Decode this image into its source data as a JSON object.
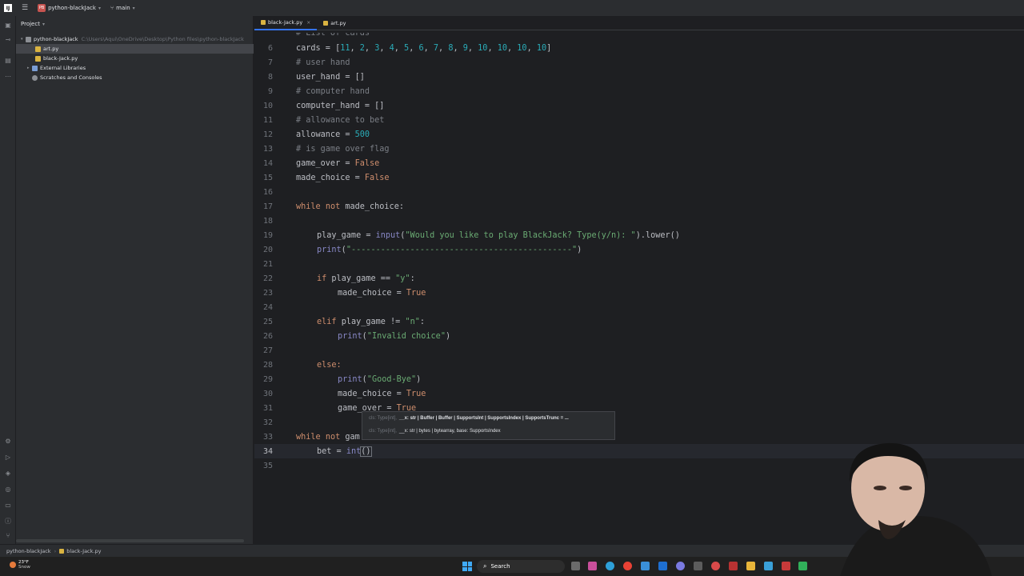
{
  "titlebar": {
    "logo": "IJ",
    "project_badge": "PB",
    "project_name": "python-blackJack",
    "branch": "main"
  },
  "project_panel": {
    "header": "Project",
    "items": [
      {
        "label": "python-blackJack",
        "path": "C:\\Users\\Aqui\\OneDrive\\Desktop\\Python files\\python-blackJack"
      },
      {
        "label": "art.py"
      },
      {
        "label": "black-Jack.py"
      },
      {
        "label": "External Libraries"
      },
      {
        "label": "Scratches and Consoles"
      }
    ]
  },
  "tabs": [
    {
      "label": "black-Jack.py"
    },
    {
      "label": "art.py"
    }
  ],
  "editor": {
    "partial_comment": "# List of cards",
    "lines": {
      "6": {
        "ln": "6"
      },
      "7": {
        "ln": "7",
        "text": "# user hand"
      },
      "8": {
        "ln": "8"
      },
      "9": {
        "ln": "9",
        "text": "# computer hand"
      },
      "10": {
        "ln": "10"
      },
      "11": {
        "ln": "11",
        "text": "# allowance to bet"
      },
      "12": {
        "ln": "12"
      },
      "13": {
        "ln": "13",
        "text": "# is game over flag"
      },
      "14": {
        "ln": "14"
      },
      "15": {
        "ln": "15"
      },
      "16": {
        "ln": "16"
      },
      "17": {
        "ln": "17"
      },
      "18": {
        "ln": "18"
      },
      "19": {
        "ln": "19"
      },
      "20": {
        "ln": "20"
      },
      "21": {
        "ln": "21"
      },
      "22": {
        "ln": "22"
      },
      "23": {
        "ln": "23"
      },
      "24": {
        "ln": "24"
      },
      "25": {
        "ln": "25"
      },
      "26": {
        "ln": "26"
      },
      "27": {
        "ln": "27"
      },
      "28": {
        "ln": "28"
      },
      "29": {
        "ln": "29"
      },
      "30": {
        "ln": "30"
      },
      "31": {
        "ln": "31"
      },
      "32": {
        "ln": "32"
      },
      "33": {
        "ln": "33"
      },
      "34": {
        "ln": "34"
      },
      "35": {
        "ln": "35"
      }
    },
    "tokens": {
      "cards": "cards",
      "eq": " = ",
      "cards_list_open": "[",
      "cards_values": [
        "11",
        "2",
        "3",
        "4",
        "5",
        "6",
        "7",
        "8",
        "9",
        "10",
        "10",
        "10",
        "10"
      ],
      "cards_list_close": "]",
      "user_hand": "user_hand",
      "empty_list": "[]",
      "computer_hand": "computer_hand",
      "allowance": "allowance",
      "allowance_value": "500",
      "game_over": "game_over",
      "made_choice": "made_choice",
      "false_kw": "False",
      "true_kw": "True",
      "while_kw": "while",
      "not_kw": "not",
      "if_kw": "if",
      "elif_kw": "elif",
      "else_kw": "else:",
      "colon": ":",
      "play_game": "play_game",
      "input_fn": "input",
      "prompt_str": "\"Would you like to play BlackJack? Type(y/n): \"",
      "lower_call": ".lower()",
      "print_fn": "print",
      "dashes_str": "\"---------------------------------------------\"",
      "eq_op": " == ",
      "neq_op": " != ",
      "y_str": "\"y\"",
      "n_str": "\"n\"",
      "invalid_str": "\"Invalid choice\"",
      "goodbye_str": "\"Good-Bye\"",
      "while_game_partial": "gam",
      "bet": "bet",
      "int_fn": "int",
      "parens": "()"
    }
  },
  "popup": {
    "row1_dim": "cls: Type[int],",
    "row1_param": "__x: str | Buffer | Buffer | SupportsInt | SupportsIndex | SupportsTrunc = ...",
    "row2_dim": "cls: Type[int],",
    "row2_param": "__x: str | bytes | bytearray, base: SupportsIndex"
  },
  "statusbar": {
    "project": "python-blackJack",
    "file": "black-Jack.py"
  },
  "taskbar": {
    "weather_temp": "23°F",
    "weather_desc": "Snow",
    "search_label": "Search"
  },
  "colors": {
    "bg": "#1e1f22",
    "panel": "#2b2d30",
    "keyword": "#cf8e6d",
    "number": "#2aacb8",
    "string": "#6aab73",
    "comment": "#7a7e85",
    "accent": "#3574f0"
  }
}
